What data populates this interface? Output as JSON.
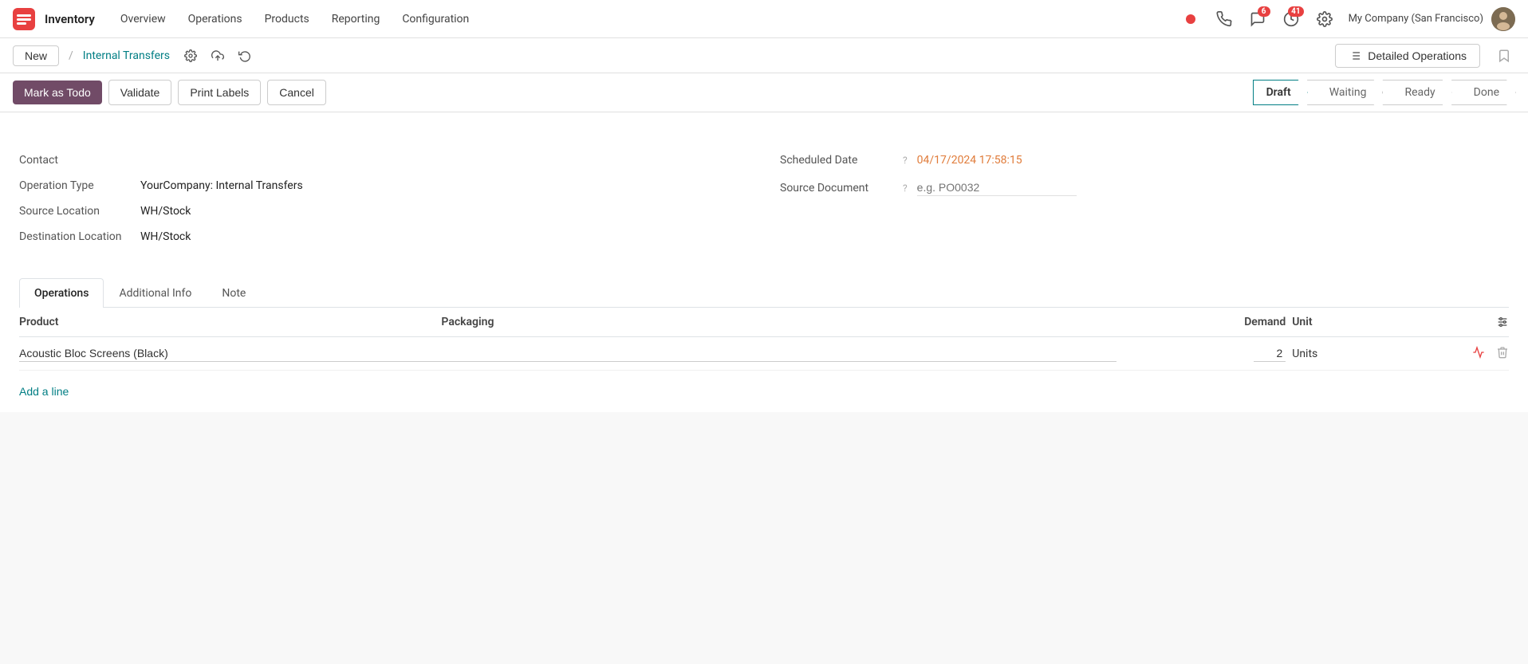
{
  "app": {
    "name": "Inventory",
    "logo_color": "#e84040"
  },
  "nav": {
    "items": [
      "Overview",
      "Operations",
      "Products",
      "Reporting",
      "Configuration"
    ],
    "company": "My Company (San Francisco)",
    "notifications_count": "6",
    "activities_count": "41"
  },
  "subnav": {
    "new_label": "New",
    "breadcrumb": "Internal Transfers",
    "detailed_ops_label": "Detailed Operations"
  },
  "actions": {
    "mark_as_todo": "Mark as Todo",
    "validate": "Validate",
    "print_labels": "Print Labels",
    "cancel": "Cancel"
  },
  "status": {
    "steps": [
      "Draft",
      "Waiting",
      "Ready",
      "Done"
    ],
    "active": "Draft"
  },
  "form": {
    "contact_label": "Contact",
    "contact_value": "",
    "operation_type_label": "Operation Type",
    "operation_type_value": "YourCompany: Internal Transfers",
    "source_location_label": "Source Location",
    "source_location_value": "WH/Stock",
    "destination_location_label": "Destination Location",
    "destination_location_value": "WH/Stock",
    "scheduled_date_label": "Scheduled Date",
    "scheduled_date_value": "04/17/2024 17:58:15",
    "source_document_label": "Source Document",
    "source_document_placeholder": "e.g. PO0032"
  },
  "tabs": {
    "items": [
      "Operations",
      "Additional Info",
      "Note"
    ],
    "active": "Operations"
  },
  "table": {
    "columns": {
      "product": "Product",
      "packaging": "Packaging",
      "demand": "Demand",
      "unit": "Unit"
    },
    "rows": [
      {
        "product": "Acoustic Bloc Screens (Black)",
        "packaging": "",
        "demand": "2",
        "unit": "Units"
      }
    ],
    "add_line_label": "Add a line"
  }
}
